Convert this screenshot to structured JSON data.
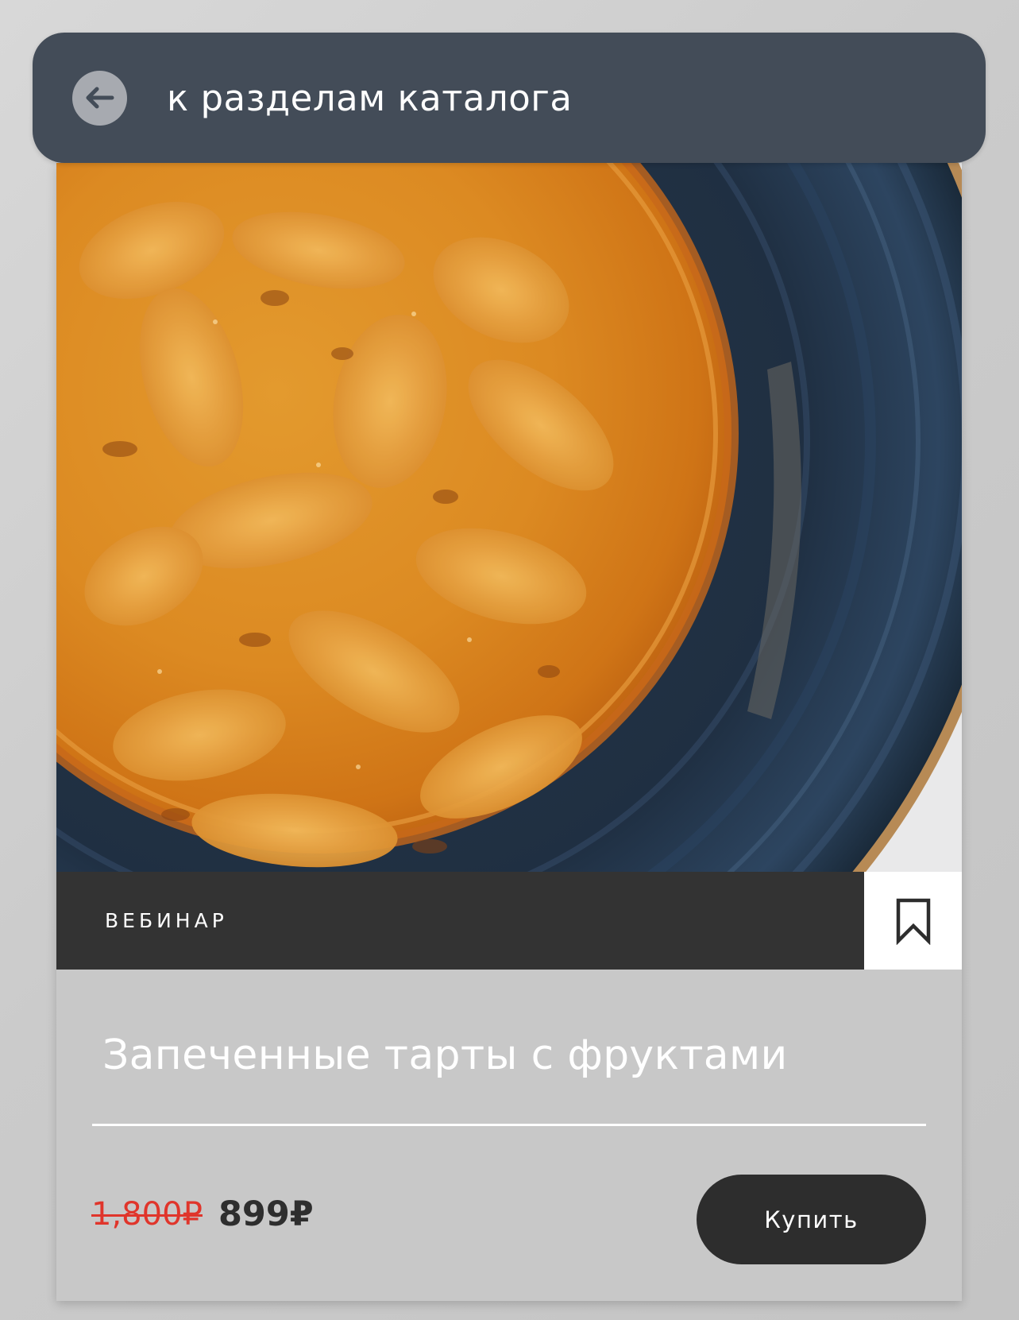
{
  "header": {
    "back_label": "к разделам каталога",
    "back_icon": "arrow-left-icon"
  },
  "product": {
    "image_subject": "tart-with-fruits-on-blue-plate",
    "type_label": "ВЕБИНАР",
    "bookmark_icon": "bookmark-icon",
    "title": "Запеченные тарты с фруктами",
    "old_price": "1,800₽",
    "new_price": "899₽",
    "buy_label": "Купить"
  },
  "colors": {
    "header_bg": "#434c58",
    "type_bar_bg": "#333333",
    "card_bg": "#c8c8c8",
    "old_price": "#e0352b",
    "button_bg": "#2d2d2d"
  }
}
